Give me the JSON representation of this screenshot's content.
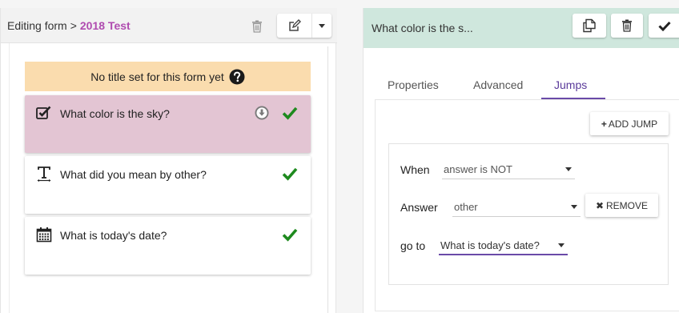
{
  "left_panel": {
    "title_prefix": "Editing form",
    "title_separator": ">",
    "form_name": "2018 Test",
    "no_title_banner": "No title set for this form yet",
    "questions": [
      {
        "label": "What color is the sky?",
        "icon": "checkbox-icon",
        "selected": true,
        "valid": true
      },
      {
        "label": "What did you mean by other?",
        "icon": "text-field-icon",
        "selected": false,
        "valid": true
      },
      {
        "label": "What is today's date?",
        "icon": "calendar-icon",
        "selected": false,
        "valid": true
      }
    ]
  },
  "right_panel": {
    "title": "What color is the s...",
    "tabs": [
      {
        "label": "Properties",
        "active": false
      },
      {
        "label": "Advanced",
        "active": false
      },
      {
        "label": "Jumps",
        "active": true
      }
    ],
    "add_jump_label": "ADD JUMP",
    "jump": {
      "when_label": "When",
      "condition": "answer is NOT",
      "answer_label": "Answer",
      "answer": "other",
      "remove_label": "REMOVE",
      "goto_label": "go to",
      "target": "What is today's date?"
    }
  },
  "colors": {
    "form_name": "#b04cb0",
    "selected_card": "#e3c5d3",
    "banner": "#fadcae",
    "right_header": "#cfe7dd",
    "accent": "#6a4aa8",
    "check": "#1e8a1e"
  }
}
